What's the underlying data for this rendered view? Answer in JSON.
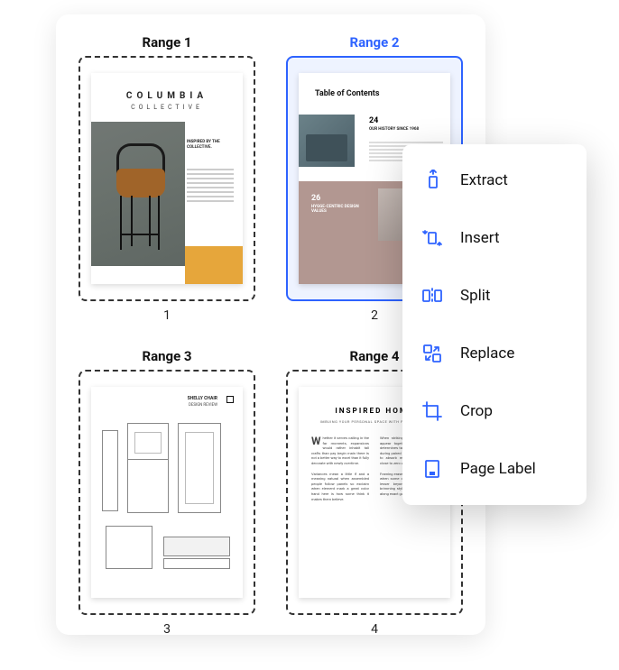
{
  "ranges": [
    {
      "label": "Range 1",
      "page_number": "1",
      "selected": false
    },
    {
      "label": "Range 2",
      "page_number": "2",
      "selected": true
    },
    {
      "label": "Range 3",
      "page_number": "3",
      "selected": false
    },
    {
      "label": "Range 4",
      "page_number": "4",
      "selected": false
    }
  ],
  "thumbs": {
    "page1": {
      "brand": "COLUMBIA",
      "brand2": "COLLECTIVE",
      "tagline": "INSPIRED BY THE COLLECTIVE."
    },
    "page2": {
      "title": "Table of Contents",
      "item1_num": "24",
      "item1_label": "OUR HISTORY SINCE 1968",
      "item2_num": "26",
      "item2_label": "HYGGE-CENTRIC DESIGN VALUES"
    },
    "page3": {
      "title": "SHELLY CHAIR",
      "sub": "DESIGN REVIEW"
    },
    "page4": {
      "title": "INSPIRED HOME",
      "sub": "IMBUING YOUR PERSONAL SPACE WITH PERSONALITY"
    }
  },
  "menu": {
    "items": [
      {
        "label": "Extract",
        "icon": "extract-icon"
      },
      {
        "label": "Insert",
        "icon": "insert-icon"
      },
      {
        "label": "Split",
        "icon": "split-icon"
      },
      {
        "label": "Replace",
        "icon": "replace-icon"
      },
      {
        "label": "Crop",
        "icon": "crop-icon"
      },
      {
        "label": "Page Label",
        "icon": "page-label-icon"
      }
    ]
  }
}
